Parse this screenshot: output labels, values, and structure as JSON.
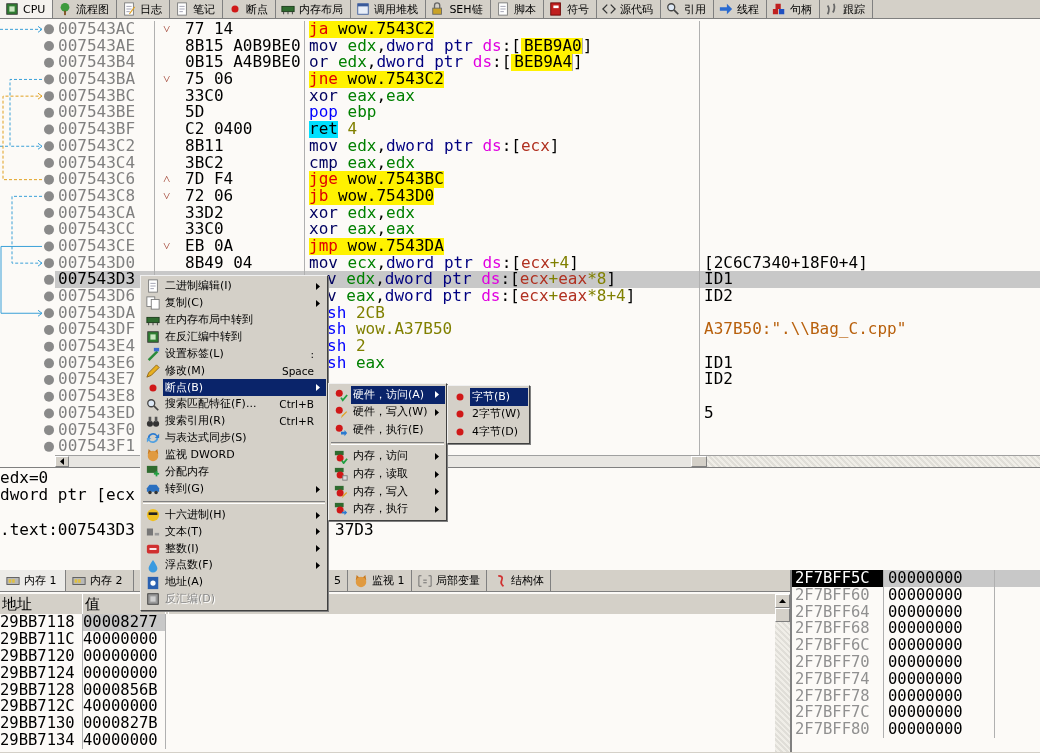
{
  "tabs": [
    {
      "label": "CPU",
      "selected": true
    },
    {
      "label": "流程图",
      "selected": false
    },
    {
      "label": "日志",
      "selected": false
    },
    {
      "label": "笔记",
      "selected": false
    },
    {
      "label": "断点",
      "selected": false
    },
    {
      "label": "内存布局",
      "selected": false
    },
    {
      "label": "调用堆栈",
      "selected": false
    },
    {
      "label": "SEH链",
      "selected": false
    },
    {
      "label": "脚本",
      "selected": false
    },
    {
      "label": "符号",
      "selected": false
    },
    {
      "label": "源代码",
      "selected": false
    },
    {
      "label": "引用",
      "selected": false
    },
    {
      "label": "线程",
      "selected": false
    },
    {
      "label": "句柄",
      "selected": false
    },
    {
      "label": "跟踪",
      "selected": false
    }
  ],
  "disassembly": {
    "rows": [
      {
        "address": "007543AC",
        "selected": false,
        "jump_mark": "˅",
        "bytes": "77 14",
        "instruction": [
          {
            "text": "ja ",
            "kind": "jcc"
          },
          {
            "text": "wow.7543C2",
            "kind": "target"
          }
        ]
      },
      {
        "address": "007543AE",
        "selected": false,
        "bytes": "8B15 A0B9BE0",
        "instruction": [
          {
            "text": "mov",
            "kind": "op"
          },
          {
            "text": " edx",
            "kind": "reg"
          },
          {
            "text": ",",
            "kind": "p"
          },
          {
            "text": "dword ptr",
            "kind": "size"
          },
          {
            "text": " ds",
            "kind": "seg"
          },
          {
            "text": ":[",
            "kind": "p"
          },
          {
            "text": "BEB9A0",
            "kind": "addr"
          },
          {
            "text": "]",
            "kind": "p"
          }
        ]
      },
      {
        "address": "007543B4",
        "selected": false,
        "bytes": "0B15 A4B9BE0",
        "instruction": [
          {
            "text": "or",
            "kind": "op"
          },
          {
            "text": " edx",
            "kind": "reg"
          },
          {
            "text": ",",
            "kind": "p"
          },
          {
            "text": "dword ptr",
            "kind": "size"
          },
          {
            "text": " ds",
            "kind": "seg"
          },
          {
            "text": ":[",
            "kind": "p"
          },
          {
            "text": "BEB9A4",
            "kind": "addr"
          },
          {
            "text": "]",
            "kind": "p"
          }
        ]
      },
      {
        "address": "007543BA",
        "selected": false,
        "jump_mark": "˅",
        "bytes": "75 06",
        "instruction": [
          {
            "text": "jne ",
            "kind": "jcc"
          },
          {
            "text": "wow.7543C2",
            "kind": "target"
          }
        ]
      },
      {
        "address": "007543BC",
        "selected": false,
        "bytes": "33C0",
        "instruction": [
          {
            "text": "xor",
            "kind": "op"
          },
          {
            "text": " eax",
            "kind": "reg"
          },
          {
            "text": ",",
            "kind": "p"
          },
          {
            "text": "eax",
            "kind": "reg"
          }
        ]
      },
      {
        "address": "007543BE",
        "selected": false,
        "bytes": "5D",
        "instruction": [
          {
            "text": "pop",
            "kind": "stk"
          },
          {
            "text": " ebp",
            "kind": "reg"
          }
        ]
      },
      {
        "address": "007543BF",
        "selected": false,
        "bytes": "C2 0400",
        "instruction": [
          {
            "text": "ret",
            "kind": "ret"
          },
          {
            "text": " 4",
            "kind": "num"
          }
        ]
      },
      {
        "address": "007543C2",
        "selected": false,
        "bytes": "8B11",
        "instruction": [
          {
            "text": "mov",
            "kind": "op"
          },
          {
            "text": " edx",
            "kind": "reg"
          },
          {
            "text": ",",
            "kind": "p"
          },
          {
            "text": "dword ptr",
            "kind": "size"
          },
          {
            "text": " ds",
            "kind": "seg"
          },
          {
            "text": ":[",
            "kind": "p"
          },
          {
            "text": "ecx",
            "kind": "mreg"
          },
          {
            "text": "]",
            "kind": "p"
          }
        ]
      },
      {
        "address": "007543C4",
        "selected": false,
        "bytes": "3BC2",
        "instruction": [
          {
            "text": "cmp",
            "kind": "op"
          },
          {
            "text": " eax",
            "kind": "reg"
          },
          {
            "text": ",",
            "kind": "p"
          },
          {
            "text": "edx",
            "kind": "reg"
          }
        ]
      },
      {
        "address": "007543C6",
        "selected": false,
        "jump_mark": "˄",
        "bytes": "7D F4",
        "instruction": [
          {
            "text": "jge ",
            "kind": "jcc"
          },
          {
            "text": "wow.7543BC",
            "kind": "target"
          }
        ]
      },
      {
        "address": "007543C8",
        "selected": false,
        "jump_mark": "˅",
        "bytes": "72 06",
        "instruction": [
          {
            "text": "jb ",
            "kind": "jcc"
          },
          {
            "text": "wow.7543D0",
            "kind": "target"
          }
        ]
      },
      {
        "address": "007543CA",
        "selected": false,
        "bytes": "33D2",
        "instruction": [
          {
            "text": "xor",
            "kind": "op"
          },
          {
            "text": " edx",
            "kind": "reg"
          },
          {
            "text": ",",
            "kind": "p"
          },
          {
            "text": "edx",
            "kind": "reg"
          }
        ]
      },
      {
        "address": "007543CC",
        "selected": false,
        "bytes": "33C0",
        "instruction": [
          {
            "text": "xor",
            "kind": "op"
          },
          {
            "text": " eax",
            "kind": "reg"
          },
          {
            "text": ",",
            "kind": "p"
          },
          {
            "text": "eax",
            "kind": "reg"
          }
        ]
      },
      {
        "address": "007543CE",
        "selected": false,
        "jump_mark": "˅",
        "bytes": "EB 0A",
        "instruction": [
          {
            "text": "jmp ",
            "kind": "jcc"
          },
          {
            "text": "wow.7543DA",
            "kind": "target"
          }
        ]
      },
      {
        "address": "007543D0",
        "selected": false,
        "bytes": "8B49 04",
        "instruction": [
          {
            "text": "mov",
            "kind": "op"
          },
          {
            "text": " ecx",
            "kind": "reg"
          },
          {
            "text": ",",
            "kind": "p"
          },
          {
            "text": "dword ptr",
            "kind": "size"
          },
          {
            "text": " ds",
            "kind": "seg"
          },
          {
            "text": ":[",
            "kind": "p"
          },
          {
            "text": "ecx",
            "kind": "mreg"
          },
          {
            "text": "+4",
            "kind": "num"
          },
          {
            "text": "]",
            "kind": "p"
          }
        ],
        "comment": {
          "text": "[2C6C7340+18F0+4]",
          "kind": "plain"
        }
      },
      {
        "address": "007543D3",
        "selected": true,
        "instruction": [
          {
            "text": "v",
            "kind": "op"
          },
          {
            "text": " edx",
            "kind": "reg"
          },
          {
            "text": ",",
            "kind": "p"
          },
          {
            "text": "dword ptr",
            "kind": "size"
          },
          {
            "text": " ds",
            "kind": "seg"
          },
          {
            "text": ":[",
            "kind": "p"
          },
          {
            "text": "ecx",
            "kind": "mreg"
          },
          {
            "text": "+",
            "kind": "num"
          },
          {
            "text": "eax",
            "kind": "mreg"
          },
          {
            "text": "*8",
            "kind": "num"
          },
          {
            "text": "]",
            "kind": "p"
          }
        ],
        "comment": {
          "text": "ID1",
          "kind": "plain"
        }
      },
      {
        "address": "007543D6",
        "selected": false,
        "instruction": [
          {
            "text": "v",
            "kind": "op"
          },
          {
            "text": " eax",
            "kind": "reg"
          },
          {
            "text": ",",
            "kind": "p"
          },
          {
            "text": "dword ptr",
            "kind": "size"
          },
          {
            "text": " ds",
            "kind": "seg"
          },
          {
            "text": ":[",
            "kind": "p"
          },
          {
            "text": "ecx",
            "kind": "mreg"
          },
          {
            "text": "+",
            "kind": "num"
          },
          {
            "text": "eax",
            "kind": "mreg"
          },
          {
            "text": "*8+4",
            "kind": "num"
          },
          {
            "text": "]",
            "kind": "p"
          }
        ],
        "comment": {
          "text": "ID2",
          "kind": "plain"
        }
      },
      {
        "address": "007543DA",
        "selected": false,
        "instruction": [
          {
            "text": "sh",
            "kind": "stk"
          },
          {
            "text": " 2CB",
            "kind": "num"
          }
        ]
      },
      {
        "address": "007543DF",
        "selected": false,
        "instruction": [
          {
            "text": "sh",
            "kind": "stk"
          },
          {
            "text": " wow.A37B50",
            "kind": "num"
          }
        ],
        "comment": {
          "text": "A37B50:\".\\\\Bag_C.cpp\"",
          "kind": "string"
        }
      },
      {
        "address": "007543E4",
        "selected": false,
        "instruction": [
          {
            "text": "sh",
            "kind": "stk"
          },
          {
            "text": " 2",
            "kind": "num"
          }
        ]
      },
      {
        "address": "007543E6",
        "selected": false,
        "instruction": [
          {
            "text": "sh",
            "kind": "stk"
          },
          {
            "text": " eax",
            "kind": "reg"
          }
        ],
        "comment": {
          "text": "ID1",
          "kind": "plain"
        }
      },
      {
        "address": "007543E7",
        "selected": false,
        "comment": {
          "text": "ID2",
          "kind": "plain"
        }
      },
      {
        "address": "007543E8",
        "selected": false
      },
      {
        "address": "007543ED",
        "selected": false,
        "comment": {
          "text": "5",
          "kind": "plain"
        }
      },
      {
        "address": "007543F0",
        "selected": false
      },
      {
        "address": "007543F1",
        "selected": false
      }
    ]
  },
  "info_panel": {
    "lines": [
      {
        "text": "edx=0"
      },
      {
        "text": "dword ptr [ecx"
      },
      {
        "text": ".text:007543D3",
        "continuation": "37D3"
      }
    ]
  },
  "bottom_tabs": [
    {
      "label": "内存 1",
      "selected": true
    },
    {
      "label": "内存 2",
      "selected": false
    },
    {
      "label": "5",
      "selected": false
    },
    {
      "label": "监视 1",
      "selected": false
    },
    {
      "label": "局部变量",
      "selected": false
    },
    {
      "label": "结构体",
      "selected": false
    }
  ],
  "memory": {
    "columns": [
      "地址",
      "值"
    ],
    "rows": [
      {
        "address": "29BB7118",
        "value": "00008277",
        "selected": true
      },
      {
        "address": "29BB711C",
        "value": "40000000",
        "selected": false
      },
      {
        "address": "29BB7120",
        "value": "00000000",
        "selected": false
      },
      {
        "address": "29BB7124",
        "value": "00000000",
        "selected": false
      },
      {
        "address": "29BB7128",
        "value": "0000856B",
        "selected": false
      },
      {
        "address": "29BB712C",
        "value": "40000000",
        "selected": false
      },
      {
        "address": "29BB7130",
        "value": "0000827B",
        "selected": false
      },
      {
        "address": "29BB7134",
        "value": "40000000",
        "selected": false
      }
    ]
  },
  "stack": {
    "rows": [
      {
        "address": "2F7BFF5C",
        "value": "00000000",
        "selected": true
      },
      {
        "address": "2F7BFF60",
        "value": "00000000",
        "selected": false
      },
      {
        "address": "2F7BFF64",
        "value": "00000000",
        "selected": false
      },
      {
        "address": "2F7BFF68",
        "value": "00000000",
        "selected": false
      },
      {
        "address": "2F7BFF6C",
        "value": "00000000",
        "selected": false
      },
      {
        "address": "2F7BFF70",
        "value": "00000000",
        "selected": false
      },
      {
        "address": "2F7BFF74",
        "value": "00000000",
        "selected": false
      },
      {
        "address": "2F7BFF78",
        "value": "00000000",
        "selected": false
      },
      {
        "address": "2F7BFF7C",
        "value": "00000000",
        "selected": false
      },
      {
        "address": "2F7BFF80",
        "value": "00000000",
        "selected": false
      }
    ]
  },
  "context_menu": {
    "items": [
      {
        "kind": "item",
        "label": "二进制编辑(I)",
        "arrow": true,
        "selected": false,
        "disabled": false
      },
      {
        "kind": "item",
        "label": "复制(C)",
        "arrow": true,
        "selected": false,
        "disabled": false
      },
      {
        "kind": "item",
        "label": "在内存布局中转到",
        "arrow": false,
        "selected": false,
        "disabled": false
      },
      {
        "kind": "item",
        "label": "在反汇编中转到",
        "arrow": false,
        "selected": false,
        "disabled": false
      },
      {
        "kind": "item",
        "label": "设置标签(L)",
        "shortcut": ":",
        "arrow": false,
        "selected": false,
        "disabled": false
      },
      {
        "kind": "item",
        "label": "修改(M)",
        "shortcut": "Space",
        "arrow": false,
        "selected": false,
        "disabled": false
      },
      {
        "kind": "item",
        "label": "断点(B)",
        "arrow": true,
        "selected": true,
        "disabled": false
      },
      {
        "kind": "item",
        "label": "搜索匹配特征(F)...",
        "shortcut": "Ctrl+B",
        "arrow": false,
        "selected": false,
        "disabled": false
      },
      {
        "kind": "item",
        "label": "搜索引用(R)",
        "shortcut": "Ctrl+R",
        "arrow": false,
        "selected": false,
        "disabled": false
      },
      {
        "kind": "item",
        "label": "与表达式同步(S)",
        "arrow": false,
        "selected": false,
        "disabled": false
      },
      {
        "kind": "item",
        "label": "监视 DWORD",
        "arrow": false,
        "selected": false,
        "disabled": false
      },
      {
        "kind": "item",
        "label": "分配内存",
        "arrow": false,
        "selected": false,
        "disabled": false
      },
      {
        "kind": "item",
        "label": "转到(G)",
        "arrow": true,
        "selected": false,
        "disabled": false
      },
      {
        "kind": "separator"
      },
      {
        "kind": "item",
        "label": "十六进制(H)",
        "arrow": true,
        "selected": false,
        "disabled": false
      },
      {
        "kind": "item",
        "label": "文本(T)",
        "arrow": true,
        "selected": false,
        "disabled": false
      },
      {
        "kind": "item",
        "label": "整数(I)",
        "arrow": true,
        "selected": false,
        "disabled": false
      },
      {
        "kind": "item",
        "label": "浮点数(F)",
        "arrow": true,
        "selected": false,
        "disabled": false
      },
      {
        "kind": "item",
        "label": "地址(A)",
        "arrow": false,
        "selected": false,
        "disabled": false
      },
      {
        "kind": "item",
        "label": "反汇编(D)",
        "arrow": false,
        "selected": false,
        "disabled": true
      }
    ]
  },
  "breakpoint_submenu": {
    "items": [
      {
        "kind": "item",
        "label": "硬件，访问(A)",
        "arrow": true,
        "selected": true,
        "disabled": false
      },
      {
        "kind": "item",
        "label": "硬件，写入(W)",
        "arrow": true,
        "selected": false,
        "disabled": false
      },
      {
        "kind": "item",
        "label": "硬件，执行(E)",
        "arrow": false,
        "selected": false,
        "disabled": false
      },
      {
        "kind": "separator"
      },
      {
        "kind": "item",
        "label": "内存，访问",
        "arrow": true,
        "selected": false,
        "disabled": false
      },
      {
        "kind": "item",
        "label": "内存，读取",
        "arrow": true,
        "selected": false,
        "disabled": false
      },
      {
        "kind": "item",
        "label": "内存，写入",
        "arrow": true,
        "selected": false,
        "disabled": false
      },
      {
        "kind": "item",
        "label": "内存，执行",
        "arrow": true,
        "selected": false,
        "disabled": false
      }
    ]
  },
  "access_submenu": {
    "items": [
      {
        "kind": "item",
        "label": "字节(B)",
        "arrow": false,
        "selected": true,
        "disabled": false
      },
      {
        "kind": "item",
        "label": "2字节(W)",
        "arrow": false,
        "selected": false,
        "disabled": false
      },
      {
        "kind": "item",
        "label": "4字节(D)",
        "arrow": false,
        "selected": false,
        "disabled": false
      }
    ]
  }
}
